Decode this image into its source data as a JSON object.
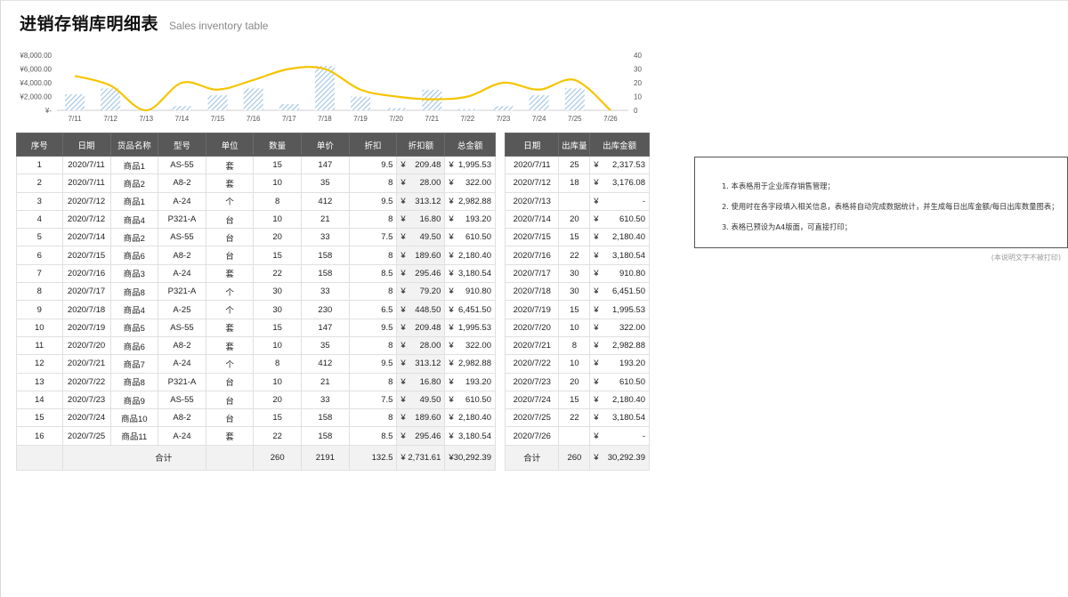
{
  "header": {
    "title": "进销存销库明细表",
    "subtitle": "Sales inventory table"
  },
  "chart_data": {
    "type": "bar+line",
    "categories": [
      "7/11",
      "7/12",
      "7/13",
      "7/14",
      "7/15",
      "7/16",
      "7/17",
      "7/18",
      "7/19",
      "7/20",
      "7/21",
      "7/22",
      "7/23",
      "7/24",
      "7/25",
      "7/26"
    ],
    "series": [
      {
        "name": "",
        "type": "bar",
        "axis": "left",
        "values": [
          2317.53,
          3176.08,
          0,
          610.5,
          2180.4,
          3180.54,
          910.8,
          6451.5,
          1995.53,
          322.0,
          2982.88,
          193.2,
          610.5,
          2180.4,
          3180.54,
          0
        ]
      },
      {
        "name": "",
        "type": "line",
        "axis": "right",
        "values": [
          25,
          18,
          0,
          20,
          15,
          22,
          30,
          30,
          15,
          10,
          8,
          10,
          20,
          15,
          22,
          0
        ]
      }
    ],
    "left_ticks": [
      "¥-",
      "¥2,000.00",
      "¥4,000.00",
      "¥6,000.00",
      "¥8,000.00"
    ],
    "right_ticks": [
      "0",
      "10",
      "20",
      "30",
      "40"
    ],
    "ylim_left": [
      0,
      8000
    ],
    "ylim_right": [
      0,
      40
    ],
    "colors": {
      "bar": "#9dc3e6",
      "line": "#f5c400"
    }
  },
  "main_table": {
    "headers": [
      "序号",
      "日期",
      "货品名称",
      "型号",
      "单位",
      "数量",
      "单价",
      "折扣",
      "折扣额",
      "总金额"
    ],
    "rows": [
      [
        "1",
        "2020/7/11",
        "商品1",
        "AS-55",
        "套",
        "15",
        "147",
        "9.5",
        "209.48",
        "1,995.53"
      ],
      [
        "2",
        "2020/7/11",
        "商品2",
        "A8-2",
        "套",
        "10",
        "35",
        "8",
        "28.00",
        "322.00"
      ],
      [
        "3",
        "2020/7/12",
        "商品1",
        "A-24",
        "个",
        "8",
        "412",
        "9.5",
        "313.12",
        "2,982.88"
      ],
      [
        "4",
        "2020/7/12",
        "商品4",
        "P321-A",
        "台",
        "10",
        "21",
        "8",
        "16.80",
        "193.20"
      ],
      [
        "5",
        "2020/7/14",
        "商品2",
        "AS-55",
        "台",
        "20",
        "33",
        "7.5",
        "49.50",
        "610.50"
      ],
      [
        "6",
        "2020/7/15",
        "商品6",
        "A8-2",
        "台",
        "15",
        "158",
        "8",
        "189.60",
        "2,180.40"
      ],
      [
        "7",
        "2020/7/16",
        "商品3",
        "A-24",
        "套",
        "22",
        "158",
        "8.5",
        "295.46",
        "3,180.54"
      ],
      [
        "8",
        "2020/7/17",
        "商品8",
        "P321-A",
        "个",
        "30",
        "33",
        "8",
        "79.20",
        "910.80"
      ],
      [
        "9",
        "2020/7/18",
        "商品4",
        "A-25",
        "个",
        "30",
        "230",
        "6.5",
        "448.50",
        "6,451.50"
      ],
      [
        "10",
        "2020/7/19",
        "商品5",
        "AS-55",
        "套",
        "15",
        "147",
        "9.5",
        "209.48",
        "1,995.53"
      ],
      [
        "11",
        "2020/7/20",
        "商品6",
        "A8-2",
        "套",
        "10",
        "35",
        "8",
        "28.00",
        "322.00"
      ],
      [
        "12",
        "2020/7/21",
        "商品7",
        "A-24",
        "个",
        "8",
        "412",
        "9.5",
        "313.12",
        "2,982.88"
      ],
      [
        "13",
        "2020/7/22",
        "商品8",
        "P321-A",
        "台",
        "10",
        "21",
        "8",
        "16.80",
        "193.20"
      ],
      [
        "14",
        "2020/7/23",
        "商品9",
        "AS-55",
        "台",
        "20",
        "33",
        "7.5",
        "49.50",
        "610.50"
      ],
      [
        "15",
        "2020/7/24",
        "商品10",
        "A8-2",
        "台",
        "15",
        "158",
        "8",
        "189.60",
        "2,180.40"
      ],
      [
        "16",
        "2020/7/25",
        "商品11",
        "A-24",
        "套",
        "22",
        "158",
        "8.5",
        "295.46",
        "3,180.54"
      ]
    ],
    "total": {
      "label": "合计",
      "qty": "260",
      "price": "2191",
      "discount": "132.5",
      "discount_amount": "2,731.61",
      "total_amount": "30,292.39"
    }
  },
  "side_table": {
    "headers": [
      "日期",
      "出库量",
      "出库金额"
    ],
    "rows": [
      [
        "2020/7/11",
        "25",
        "2,317.53"
      ],
      [
        "2020/7/12",
        "18",
        "3,176.08"
      ],
      [
        "2020/7/13",
        "",
        "-"
      ],
      [
        "2020/7/14",
        "20",
        "610.50"
      ],
      [
        "2020/7/15",
        "15",
        "2,180.40"
      ],
      [
        "2020/7/16",
        "22",
        "3,180.54"
      ],
      [
        "2020/7/17",
        "30",
        "910.80"
      ],
      [
        "2020/7/18",
        "30",
        "6,451.50"
      ],
      [
        "2020/7/19",
        "15",
        "1,995.53"
      ],
      [
        "2020/7/20",
        "10",
        "322.00"
      ],
      [
        "2020/7/21",
        "8",
        "2,982.88"
      ],
      [
        "2020/7/22",
        "10",
        "193.20"
      ],
      [
        "2020/7/23",
        "20",
        "610.50"
      ],
      [
        "2020/7/24",
        "15",
        "2,180.40"
      ],
      [
        "2020/7/25",
        "22",
        "3,180.54"
      ],
      [
        "2020/7/26",
        "",
        "-"
      ]
    ],
    "total": {
      "label": "合计",
      "qty": "260",
      "amount": "30,292.39"
    }
  },
  "currency_symbol": "¥",
  "notes": {
    "lines": [
      "1. 本表格用于企业库存销售管理；",
      "2. 使用时在各字段填入相关信息，表格将自动完成数据统计，并生成每日出库金额/每日出库数量图表；",
      "3. 表格已预设为A4版面，可直接打印；"
    ],
    "footer": "(本说明文字不被打印)"
  }
}
